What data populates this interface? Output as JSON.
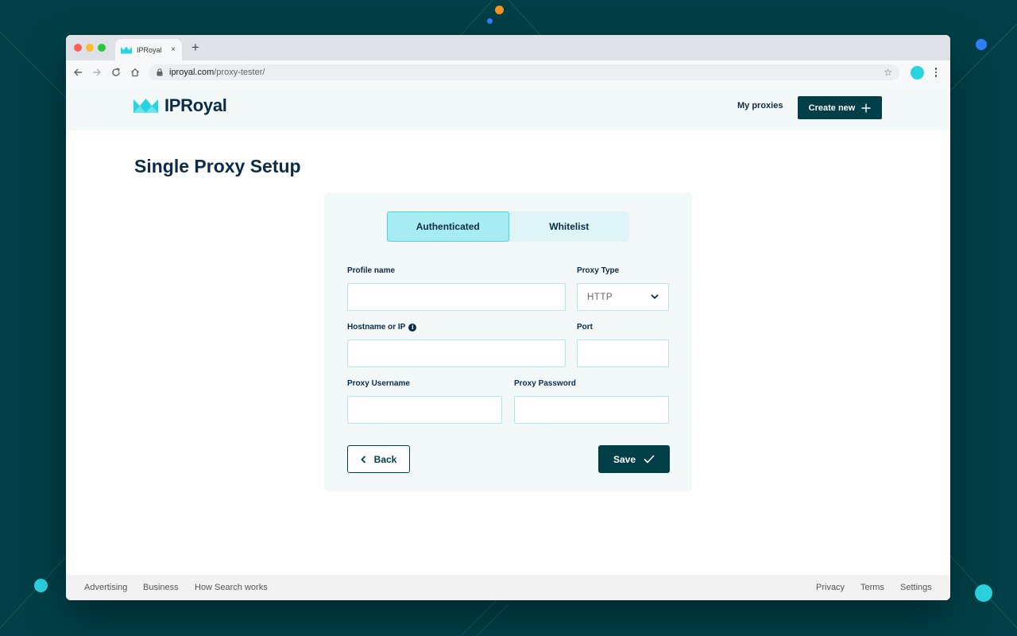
{
  "browser": {
    "tab_title": "IPRoyal",
    "tab_close": "×",
    "new_tab": "+",
    "url_host": "iproyal.com",
    "url_path": "/proxy-tester/"
  },
  "header": {
    "logo_text": "IPRoyal",
    "nav_my_proxies": "My proxies",
    "create_new": "Create new"
  },
  "page": {
    "title": "Single Proxy Setup"
  },
  "form": {
    "tabs": [
      {
        "label": "Authenticated",
        "active": true
      },
      {
        "label": "Whitelist",
        "active": false
      }
    ],
    "labels": {
      "profile_name": "Profile name",
      "proxy_type": "Proxy Type",
      "hostname": "Hostname or IP",
      "port": "Port",
      "username": "Proxy Username",
      "password": "Proxy Password"
    },
    "values": {
      "profile_name": "",
      "hostname": "",
      "port": "",
      "username": "",
      "password": ""
    },
    "proxy_type_selected": "HTTP",
    "info_glyph": "i",
    "back_label": "Back",
    "save_label": "Save"
  },
  "footer": {
    "left": [
      "Advertising",
      "Business",
      "How Search works"
    ],
    "right": [
      "Privacy",
      "Terms",
      "Settings"
    ]
  },
  "colors": {
    "background": "#003f47",
    "brand_dark": "#003f47",
    "accent_cyan": "#2ad3e0",
    "text_navy": "#0b2c49"
  }
}
